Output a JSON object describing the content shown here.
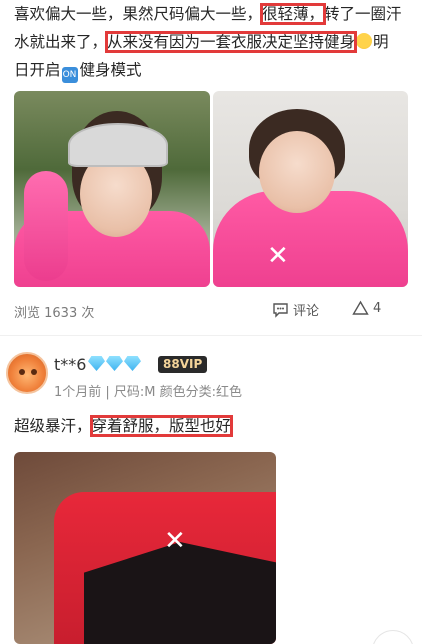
{
  "review1": {
    "p1": "喜欢偏大一些，果然尺码偏大一些，",
    "h1": "很轻薄，",
    "p2": "转了一圈汗",
    "p3": "水就出来了，",
    "h2": "从来没有因为一套衣服决定坚持健身",
    "p4": "明",
    "p5": "日开启",
    "on_icon": "ON",
    "p6": "健身模式",
    "highlight_color": "#e23a3a"
  },
  "meta": {
    "views": "浏览 1633 次",
    "comment_label": "评论",
    "like_count": "4"
  },
  "reviewer": {
    "username": "t**6",
    "vip_badge": "88VIP",
    "submeta": "1个月前 | 尺码:M  颜色分类:红色"
  },
  "review2": {
    "p1": "超级暴汗，",
    "h1": "穿着舒服，版型也好"
  },
  "colors": {
    "accent_pink": "#ee3f8f",
    "highlight_red": "#e23a3a",
    "vip_gold": "#f4d49a",
    "diamond_blue": "#3fb3ef"
  }
}
